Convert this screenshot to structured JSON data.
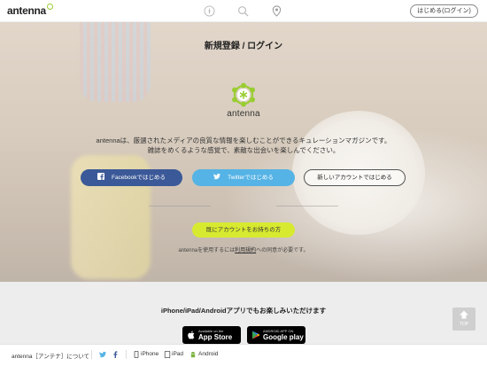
{
  "header": {
    "logo_text": "antenna",
    "nav_icons": [
      "compass-icon",
      "search-icon",
      "location-pin-icon"
    ],
    "login_label": "はじめる(ログイン)"
  },
  "hero": {
    "title": "新規登録 / ログイン",
    "brand_name": "antenna",
    "description_line1": "antennaは、厳選されたメディアの良質な情報を楽しむことができるキュレーションマガジンです。",
    "description_line2": "雑誌をめくるような感覚で、素敵な出会いを楽しんでください。",
    "facebook_label": "Facebookではじめる",
    "twitter_label": "Twitterではじめる",
    "new_account_label": "新しいアカウントではじめる",
    "existing_account_label": "既にアカウントをお持ちの方",
    "terms_prefix": "antennaを使用するには",
    "terms_link": "利用規約",
    "terms_suffix": "への同意が必要です。",
    "colors": {
      "facebook": "#3b5998",
      "twitter": "#55b3e5",
      "accent": "#d8ea30",
      "brand_green": "#9acd32"
    }
  },
  "apps": {
    "headline": "iPhone/iPad/Androidアプリでもお楽しみいただけます",
    "appstore_small": "Available on the",
    "appstore_big": "App Store",
    "gplay_small": "ANDROID APP ON",
    "gplay_big": "Google play"
  },
  "back_to_top": {
    "label": "TOP"
  },
  "footer": {
    "about": "antenna［アンテナ］について",
    "iphone": "iPhone",
    "ipad": "iPad",
    "android": "Android"
  }
}
